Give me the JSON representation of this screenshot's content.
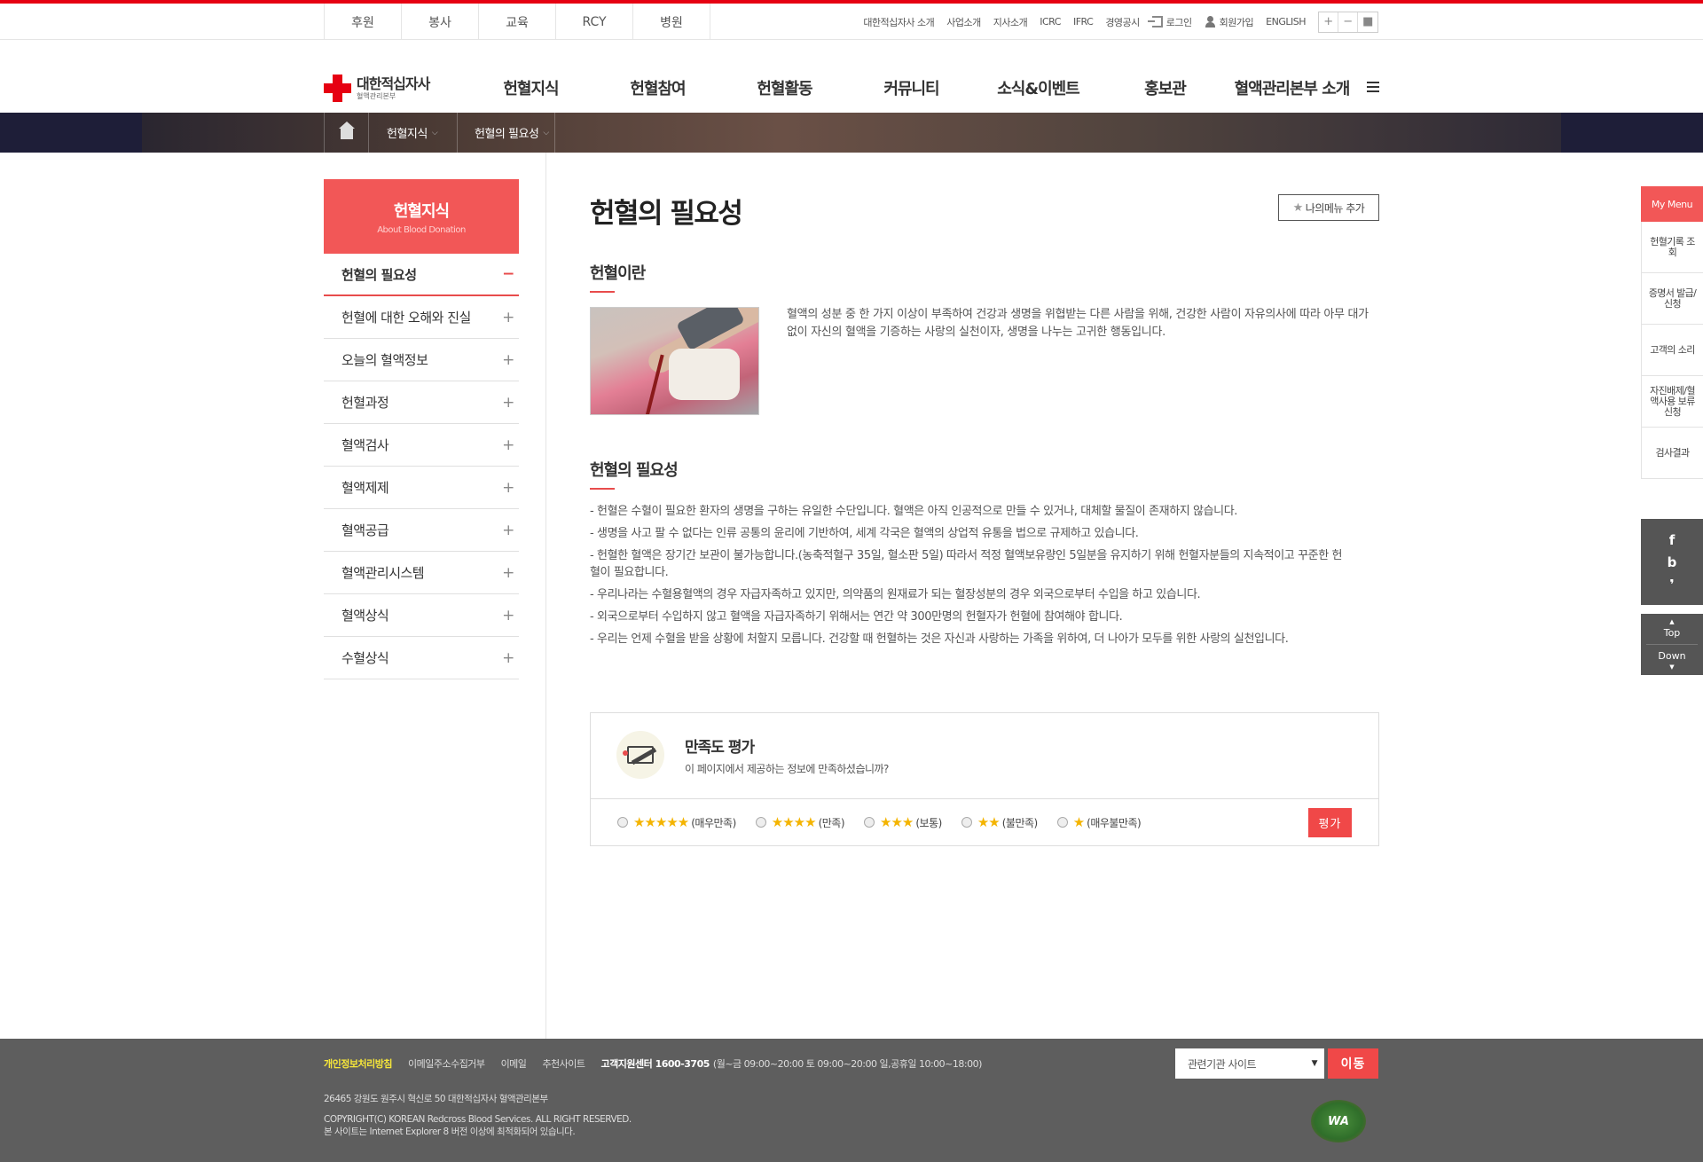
{
  "util": {
    "quick_links": [
      "후원",
      "봉사",
      "교육",
      "RCY",
      "병원"
    ],
    "links": [
      "대한적십자사 소개",
      "사업소개",
      "지사소개",
      "ICRC",
      "IFRC",
      "경영공시"
    ],
    "login": "로그인",
    "signup": "회원가입",
    "english": "ENGLISH",
    "zoom": [
      "+",
      "−",
      "■"
    ]
  },
  "logo": {
    "name": "대한적십자사",
    "sub": "혈액관리본부"
  },
  "gnb": [
    "헌혈지식",
    "헌혈참여",
    "헌혈활동",
    "커뮤니티",
    "소식&이벤트",
    "홍보관",
    "혈액관리본부 소개"
  ],
  "breadcrumb": {
    "level1": "헌혈지식",
    "level2": "헌혈의 필요성"
  },
  "lnb": {
    "title": "헌혈지식",
    "subtitle": "About Blood Donation",
    "items": [
      {
        "label": "헌혈의 필요성",
        "sign": "−"
      },
      {
        "label": "헌혈에 대한 오해와 진실",
        "sign": "+"
      },
      {
        "label": "오늘의 혈액정보",
        "sign": "+"
      },
      {
        "label": "헌혈과정",
        "sign": "+"
      },
      {
        "label": "혈액검사",
        "sign": "+"
      },
      {
        "label": "혈액제제",
        "sign": "+"
      },
      {
        "label": "혈액공급",
        "sign": "+"
      },
      {
        "label": "혈액관리시스템",
        "sign": "+"
      },
      {
        "label": "혈액상식",
        "sign": "+"
      },
      {
        "label": "수혈상식",
        "sign": "+"
      }
    ]
  },
  "content": {
    "title": "헌혈의 필요성",
    "mymenu_add": "나의메뉴 추가",
    "section1_title": "헌혈이란",
    "section1_text": "혈액의 성분 중 한 가지 이상이 부족하여 건강과 생명을 위협받는 다른 사람을 위해, 건강한 사람이 자유의사에 따라 아무 대가 없이 자신의 혈액을 기증하는 사랑의 실천이자, 생명을 나누는 고귀한 행동입니다.",
    "section2_title": "헌혈의 필요성",
    "needs": [
      "- 헌혈은 수혈이 필요한 환자의 생명을 구하는 유일한 수단입니다. 혈액은 아직 인공적으로 만들 수 있거나, 대체할 물질이 존재하지 않습니다.",
      "- 생명을 사고 팔 수 없다는 인류 공통의 윤리에 기반하여, 세계 각국은 혈액의 상업적 유통을 법으로 규제하고 있습니다.",
      "- 헌혈한 혈액은 장기간 보관이 불가능합니다.(농축적혈구 35일, 혈소판 5일) 따라서 적정 혈액보유량인 5일분을 유지하기 위해 헌혈자분들의 지속적이고 꾸준한 헌혈이 필요합니다.",
      "- 우리나라는 수혈용혈액의 경우 자급자족하고 있지만, 의약품의 원재료가 되는 혈장성분의 경우 외국으로부터 수입을 하고 있습니다.",
      "- 외국으로부터 수입하지 않고 혈액을 자급자족하기 위해서는 연간 약 300만명의 헌혈자가 헌혈에 참여해야 합니다.",
      "- 우리는 언제 수혈을 받을 상황에 처할지 모릅니다. 건강할 때 헌혈하는 것은 자신과 사랑하는 가족을 위하여, 더 나아가 모두를 위한 사랑의 실천입니다."
    ]
  },
  "survey": {
    "title": "만족도 평가",
    "question": "이 페이지에서 제공하는 정보에 만족하셨습니까?",
    "options": [
      {
        "stars": "★★★★★",
        "label": "(매우만족)",
        "rating": 5
      },
      {
        "stars": "★★★★",
        "label": "(만족)",
        "rating": 4
      },
      {
        "stars": "★★★",
        "label": "(보통)",
        "rating": 3
      },
      {
        "stars": "★★",
        "label": "(불만족)",
        "rating": 2
      },
      {
        "stars": "★",
        "label": "(매우불만족)",
        "rating": 1
      }
    ],
    "submit": "평가"
  },
  "side_quick": {
    "title": "My Menu",
    "items": [
      "헌혈기록 조회",
      "증명서 발급/신청",
      "고객의 소리",
      "자진배제/혈액사용 보류신청",
      "검사결과"
    ],
    "sns": [
      "f",
      "b",
      "❜"
    ],
    "top": "Top",
    "down": "Down"
  },
  "footer": {
    "privacy": "개인정보처리방침",
    "email_refuse": "이메일주소수집거부",
    "email": "이메일",
    "recommend": "추천사이트",
    "call_center": "고객지원센터 1600-3705",
    "hours": "(월~금 09:00~20:00 토 09:00~20:00 일,공휴일 10:00~18:00)",
    "address": "26465 강원도 원주시 혁신로 50 대한적십자사 혈액관리본부",
    "copyright": "COPYRIGHT(C) KOREAN Redcross Blood Services. ALL RIGHT RESERVED.",
    "browser_note": "본 사이트는 Internet Explorer 8 버전 이상에 최적화되어 있습니다.",
    "related_select": "관련기관 사이트",
    "go": "이동",
    "wa_mark": "WA"
  }
}
